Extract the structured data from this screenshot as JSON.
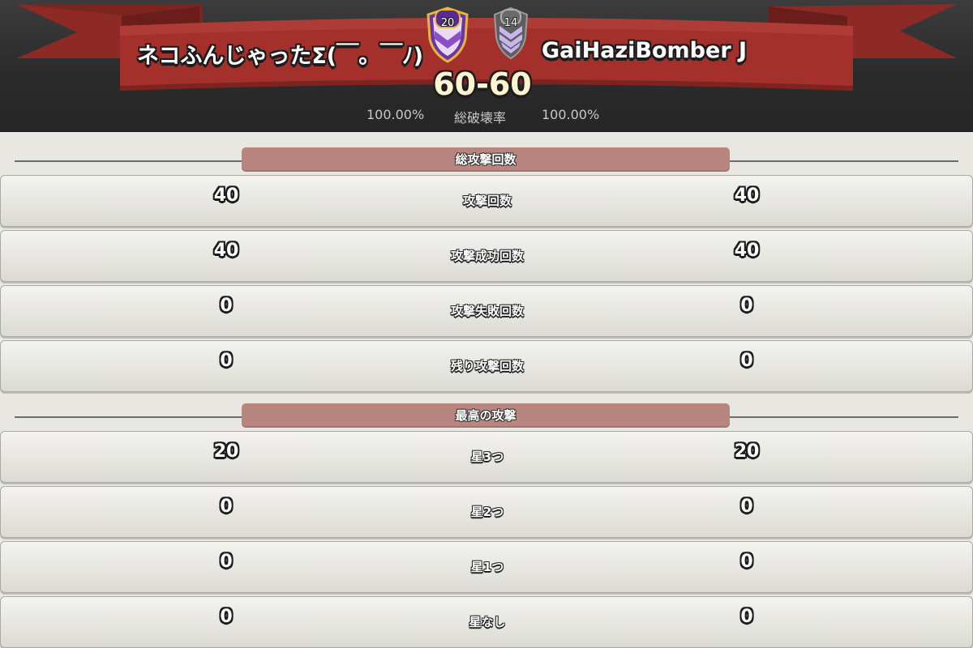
{
  "header": {
    "clan_left": {
      "name": "ネコふんじゃったΣ(￣。￣ﾉ)",
      "level": "20",
      "destruction": "100.00%"
    },
    "clan_right": {
      "name": "GaiHaziBomber J",
      "level": "14",
      "destruction": "100.00%"
    },
    "score": "60-60",
    "destruction_label": "総破壊率"
  },
  "sections": [
    {
      "title": "総攻撃回数",
      "rows": [
        {
          "label": "攻撃回数",
          "left": "40",
          "right": "40"
        },
        {
          "label": "攻撃成功回数",
          "left": "40",
          "right": "40"
        },
        {
          "label": "攻撃失敗回数",
          "left": "0",
          "right": "0"
        },
        {
          "label": "残り攻撃回数",
          "left": "0",
          "right": "0"
        }
      ]
    },
    {
      "title": "最高の攻撃",
      "rows": [
        {
          "label": "星3つ",
          "left": "20",
          "right": "20"
        },
        {
          "label": "星2つ",
          "left": "0",
          "right": "0"
        },
        {
          "label": "星1つ",
          "left": "0",
          "right": "0"
        },
        {
          "label": "星なし",
          "left": "0",
          "right": "0"
        }
      ]
    }
  ],
  "colors": {
    "ribbon": "#a3302b",
    "section_pill": "#b9857f",
    "row_bg": "#e8e7e1",
    "badge_left": "#8a4fc8",
    "badge_right": "#7a7a7a"
  }
}
